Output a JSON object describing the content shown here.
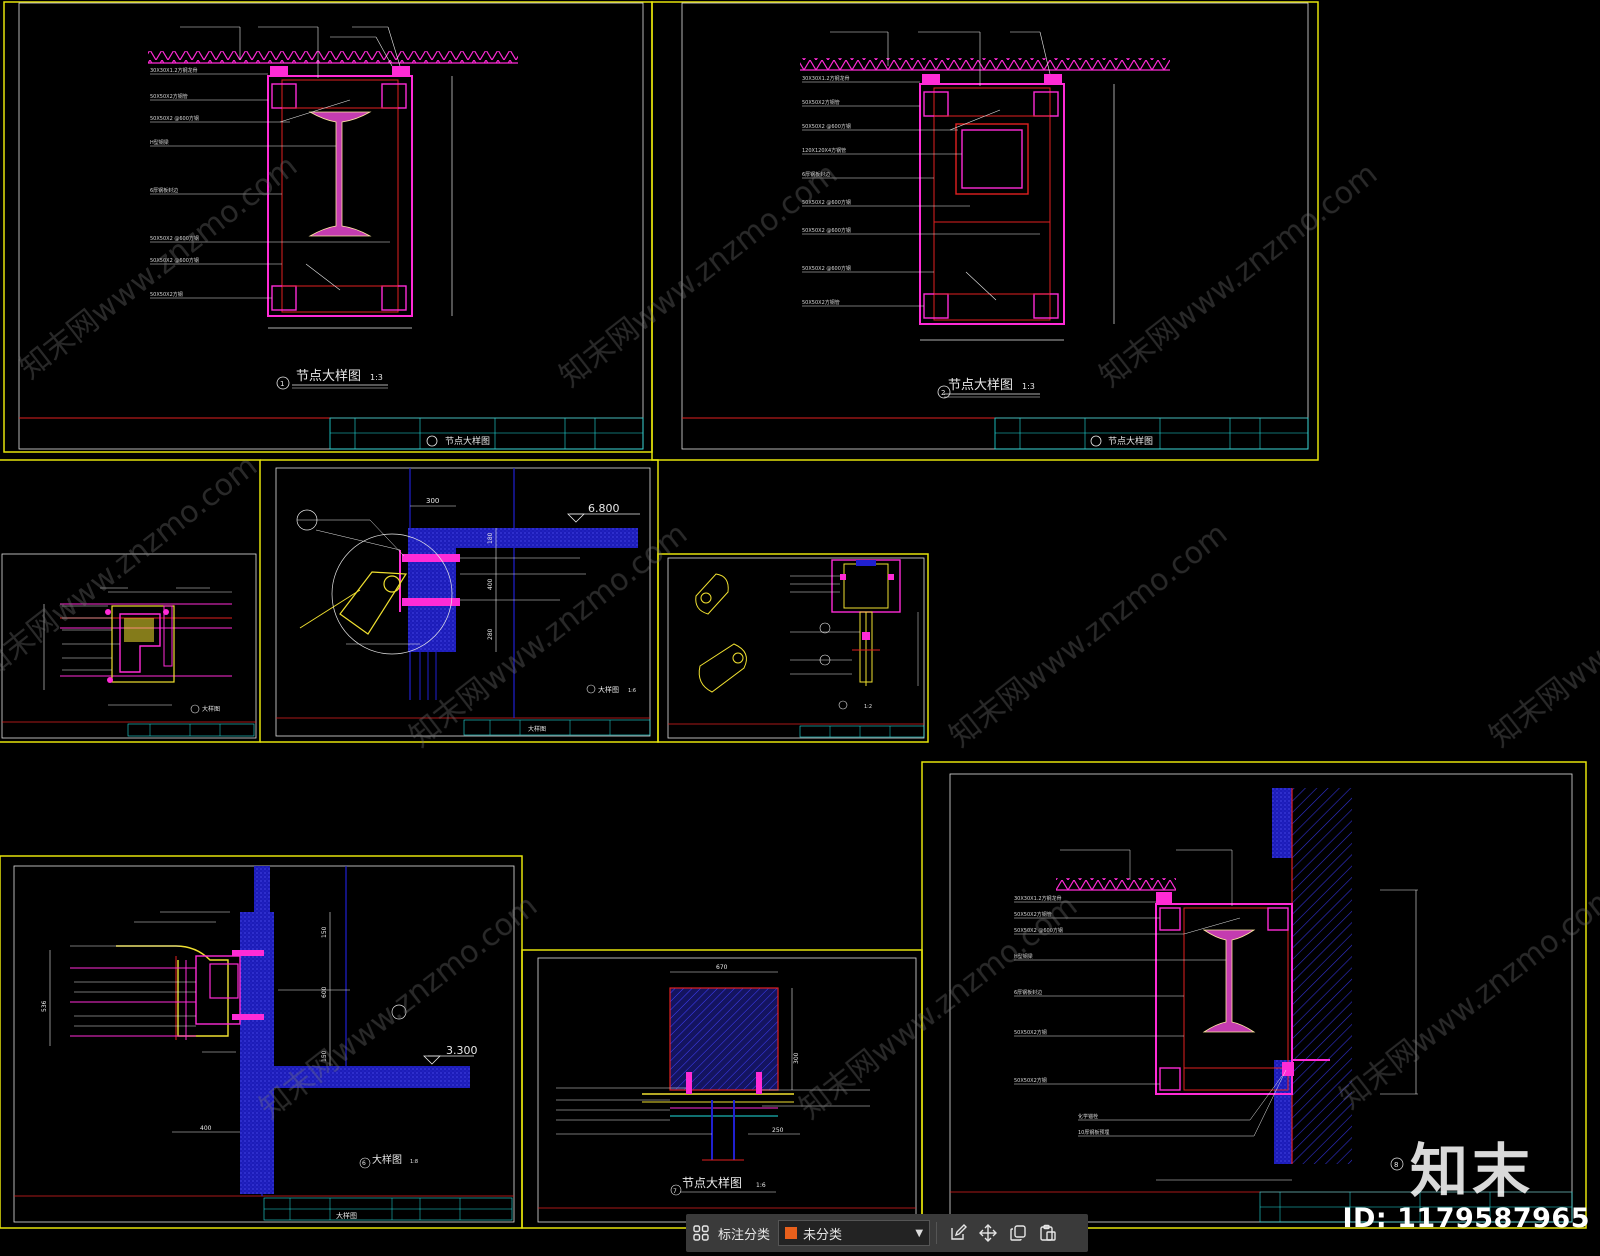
{
  "drawing_titles": {
    "d1": "节点大样图",
    "d1_scale": "1:3",
    "d2": "节点大样图",
    "d2_scale": "1:3",
    "d3": "大样图",
    "d4": "大样图",
    "d4_scale": "1:6",
    "d5_scale": "1:2",
    "d6": "大样图",
    "d6_scale": "1:8",
    "d7": "节点大样图",
    "d7_scale": "1:6"
  },
  "title_blocks": {
    "tb1": "节点大样图",
    "tb2": "节点大样图",
    "tb6": "大样图"
  },
  "markers": {
    "m1": "1",
    "m2": "2",
    "m7": "7",
    "m8": "8",
    "m6": "6",
    "m4": "4"
  },
  "elevations": {
    "e1": "6.800",
    "e2": "3.300"
  },
  "dimensions": {
    "d4_top": "300",
    "d4_v1": "180",
    "d4_v2": "400",
    "d4_v3": "280",
    "d6_v1": "150",
    "d6_v2": "600",
    "d6_v3": "150",
    "d6_h": "400",
    "d6_left": "536",
    "d7_h1": "670",
    "d7_v": "300",
    "d7_bot": "250"
  },
  "watermarks": {
    "text": "知末网www.znzmo.com",
    "logo": "知末",
    "id": "ID: 1179587965"
  },
  "toolbar": {
    "grid_icon": "grid-icon",
    "label": "标注分类",
    "select_value": "未分类",
    "select_swatch_color": "#e8601c",
    "tools": [
      "edit-icon",
      "move-icon",
      "copy-icon",
      "paste-icon"
    ]
  },
  "colors": {
    "frame": "#e5e20a",
    "magenta": "#ff2bd6",
    "red": "#e02020",
    "blue": "#2020d0",
    "cyan": "#20e0e0",
    "yellow": "#f0e030"
  }
}
